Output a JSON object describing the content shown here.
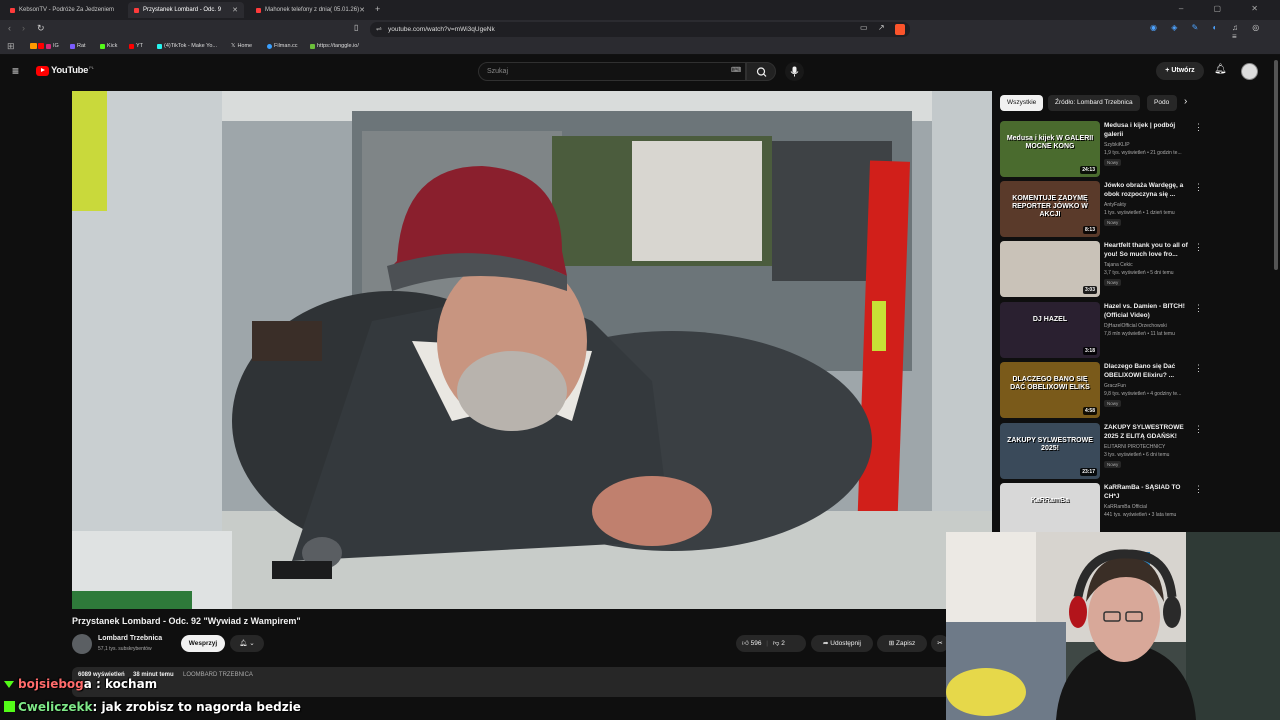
{
  "browser": {
    "tabs": [
      {
        "title": "KebsonTV - Podróże Za Jedzeniem",
        "active": false
      },
      {
        "title": "Przystanek Lombard - Odc. 9",
        "active": true
      },
      {
        "title": "Mahonek telefony z dnia( 05.01.26)",
        "active": false
      }
    ],
    "new_tab": "+",
    "url": "youtube.com/watch?v=mWi3qUgeNk",
    "bookmarks": [
      "IG",
      "Rat",
      "Kick",
      "YT",
      "(4)TikTok - Make Yo...",
      "Home",
      "Filman.cc",
      "https://tanggle.io/"
    ],
    "colors": {
      "accent": "#ff0000"
    }
  },
  "youtube": {
    "logo": "YouTube",
    "logo_sup": "PL",
    "search_placeholder": "Szukaj",
    "create_label": "Utwórz"
  },
  "video": {
    "title": "Przystanek Lombard - Odc. 92 \"Wywiad z Wampirem\"",
    "channel": "Lombard Trzebnica",
    "subscribers": "57,1 tys. subskrybentów",
    "support_label": "Wesprzyj",
    "likes": "596",
    "dislikes": "2",
    "share_label": "Udostępnij",
    "save_label": "Zapisz",
    "views": "6089 wyświetleń",
    "time_ago": "38 minut temu",
    "tag": "LOOMBARD TRZEBNICA"
  },
  "sidebar": {
    "chips": [
      "Wszystkie",
      "Źródło: Lombard Trzebnica",
      "Podo"
    ],
    "recommendations": [
      {
        "title": "Medusa i kijek | podbój galerii",
        "channel": "SzybkiKLIP",
        "stats": "1,9 tys. wyświetleń • 21 godzin te...",
        "badge": "Nowy",
        "duration": "24:13",
        "thumb_text": "Medusa i kijek W GALERII MOCNE KONG",
        "thumb_color": "#4a6b2e"
      },
      {
        "title": "Jówko obraża Wardęgę, a obok rozpoczyna się ...",
        "channel": "AntyFakty",
        "stats": "1 tys. wyświetleń • 1 dzień temu",
        "badge": "Nowy",
        "duration": "8:13",
        "thumb_text": "KOMENTUJE ZADYMĘ REPORTER JÓWKO W AKCJI",
        "thumb_color": "#5a3a2a"
      },
      {
        "title": "Heartfelt thank you to all of you! So much love fro...",
        "channel": "Tajana Cekic",
        "stats": "3,7 tys. wyświetleń • 5 dni temu",
        "badge": "Nowy",
        "duration": "3:03",
        "thumb_text": "",
        "thumb_color": "#c9c2b8"
      },
      {
        "title": "Hazel vs. Damien - BITCH! (Official Video)",
        "channel": "DjHazelOfficial Orzechowski",
        "stats": "7,8 mln wyświetleń • 11 lat temu",
        "badge": "",
        "duration": "3:18",
        "thumb_text": "DJ HAZEL",
        "thumb_color": "#2a2030"
      },
      {
        "title": "Dlaczego Bano się Dać OBELIXOWI Elixiru? ...",
        "channel": "GraczFun",
        "stats": "9,8 tys. wyświetleń • 4 godziny te...",
        "badge": "Nowy",
        "duration": "4:58",
        "thumb_text": "DLACZEGO BANO SIĘ DAĆ OBELIXOWI ELIKS",
        "thumb_color": "#7a5a1a"
      },
      {
        "title": "ZAKUPY SYLWESTROWE 2025 Z ELITĄ GDAŃSK!",
        "channel": "ELITARNI PIROTECHNICY",
        "stats": "3 tys. wyświetleń • 6 dni temu",
        "badge": "Nowy",
        "duration": "23:17",
        "thumb_text": "ZAKUPY SYLWESTROWE 2025!",
        "thumb_color": "#3a4a5a"
      },
      {
        "title": "KaRRamBa - SĄSIAD TO CH*J",
        "channel": "KaRRamBa Official",
        "stats": "441 tys. wyświetleń • 3 lata temu",
        "badge": "",
        "duration": "",
        "thumb_text": "KaRRamBa",
        "thumb_color": "#d8d8d8"
      }
    ]
  },
  "chat": {
    "line1_user": "bojsiebog",
    "line1_text": "a : kocham",
    "line2_user": "Cweliczekk",
    "line2_text": ": jak zrobisz to nagorda bedzie"
  }
}
